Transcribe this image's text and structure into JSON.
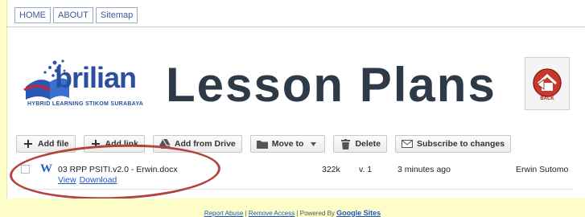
{
  "nav": {
    "tabs": [
      "HOME",
      "ABOUT",
      "Sitemap"
    ]
  },
  "logo": {
    "brand": "brilian",
    "tagline": "HYBRID LEARNING STIKOM SURABAYA"
  },
  "page": {
    "title": "Lesson Plans",
    "back_label": "BACK"
  },
  "toolbar": {
    "add_file": "Add file",
    "add_link": "Add link",
    "add_from_drive": "Add from Drive",
    "move_to": "Move to",
    "delete": "Delete",
    "subscribe": "Subscribe to changes"
  },
  "files": [
    {
      "name": "03 RPP PSITI.v2.0 - Erwin.docx",
      "view": "View",
      "download": "Download",
      "size": "322k",
      "version": "v. 1",
      "modified": "3 minutes ago",
      "user": "Erwin Sutomo"
    }
  ],
  "footer": {
    "report_abuse": "Report Abuse",
    "sep1": "|",
    "remove_access": "Remove Access",
    "sep2": "|",
    "powered_by": "Powered By",
    "google_sites": "Google Sites"
  },
  "colors": {
    "background": "#fdfdc8",
    "title": "#2e3a47",
    "link": "#2255cc",
    "annotation": "#b3433c"
  }
}
